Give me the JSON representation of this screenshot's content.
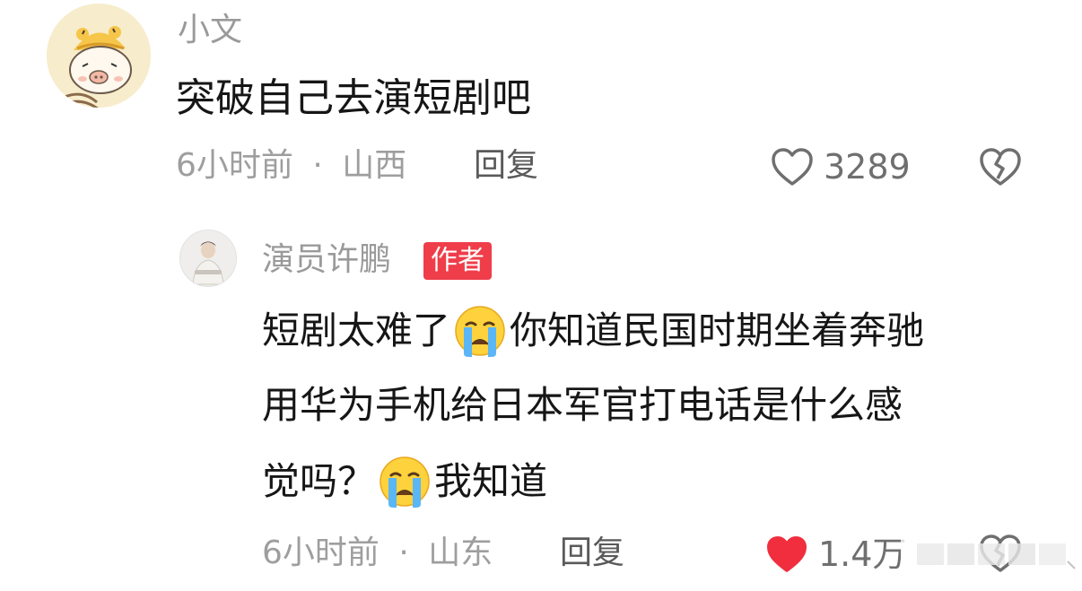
{
  "comment": {
    "username": "小文",
    "text": "突破自己去演短剧吧",
    "time": "6小时前",
    "separator": "·",
    "location": "山西",
    "reply_label": "回复",
    "like_count": "3289"
  },
  "reply": {
    "username": "演员许鹏",
    "badge": "作者",
    "line1_part1": "短剧太难了",
    "line1_part2": "你知道民国时期坐着奔驰",
    "line2": "用华为手机给日本军官打电话是什么感",
    "line3_part1": "觉吗？",
    "line3_part2": "我知道",
    "emoji": "crying-face",
    "time": "6小时前",
    "separator": "·",
    "location": "山东",
    "reply_label": "回复",
    "like_count": "1.4万"
  },
  "colors": {
    "like_active": "#f02e3e",
    "badge": "#ef3d4a",
    "meta_text": "#9e9e9e",
    "body_text": "#161616"
  }
}
